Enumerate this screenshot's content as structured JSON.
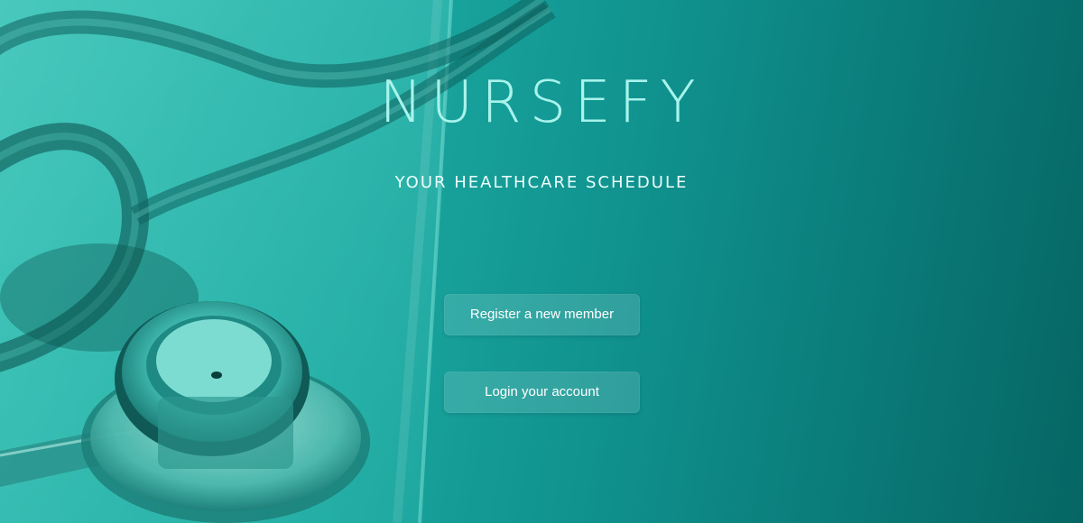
{
  "brand": {
    "title": "NURSEFY",
    "tagline": "YOUR HEALTHCARE SCHEDULE"
  },
  "actions": {
    "register_label": "Register a new member",
    "login_label": "Login your account"
  },
  "colors": {
    "background_left": "#2fb9ad",
    "background_right": "#066663",
    "title": "#a8f4ec",
    "text": "#ffffff"
  },
  "icons": {
    "background_image": "stethoscope-illustration"
  }
}
